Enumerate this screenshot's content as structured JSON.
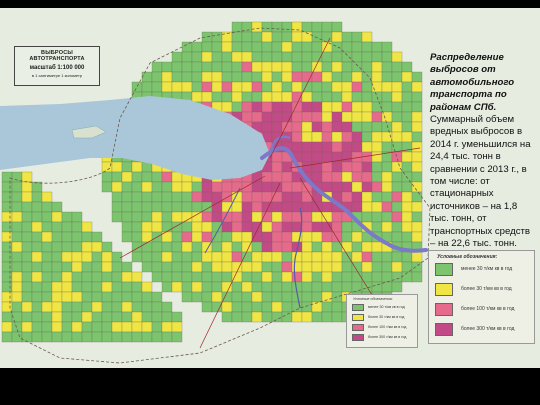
{
  "map": {
    "title_line1": "ВЫБРОСЫ АВТОТРАНСПОРТА",
    "title_line2": "масштаб 1:100 000",
    "title_line3": "в 1 сантиметре 1 километр"
  },
  "description": {
    "heading": "Распределение выбросов от автомобильного транспорта по районам СПб.",
    "body": "Суммарный объем вредных выбросов в 2014 г. уменьшился на 24,4 тыс. тонн в сравнении с 2013 г., в том числе: от стационарных источников – на 1,8 тыс. тонн, от транспортных средств – на 22,6 тыс. тонн."
  },
  "legend_right": {
    "title": "Условные обозначения:",
    "items": [
      {
        "label": "менее 30 т/км кв в год",
        "color": "#7cc46e"
      },
      {
        "label": "более 30 т/км кв в год",
        "color": "#efe545"
      },
      {
        "label": "более 100 т/км кв в год",
        "color": "#e56a8c"
      },
      {
        "label": "более 300 т/км кв в год",
        "color": "#c24a86"
      }
    ]
  },
  "legend_left": {
    "title": "Условные обозначения:",
    "items": [
      {
        "label": "менее 30 т/км кв в год",
        "color": "#7cc46e"
      },
      {
        "label": "более 30 т/км кв в год",
        "color": "#efe545"
      },
      {
        "label": "более 100 т/км кв в год",
        "color": "#e56a8c"
      },
      {
        "label": "более 300 т/км кв в год",
        "color": "#c24a86"
      }
    ]
  },
  "colors": {
    "background": "#000000",
    "paper": "#e7ece0",
    "water": "#a9c7d8",
    "river": "#7b79c9",
    "low": "#7cc46e",
    "medium": "#efe545",
    "high": "#e56a8c",
    "very_high": "#c24a86"
  }
}
